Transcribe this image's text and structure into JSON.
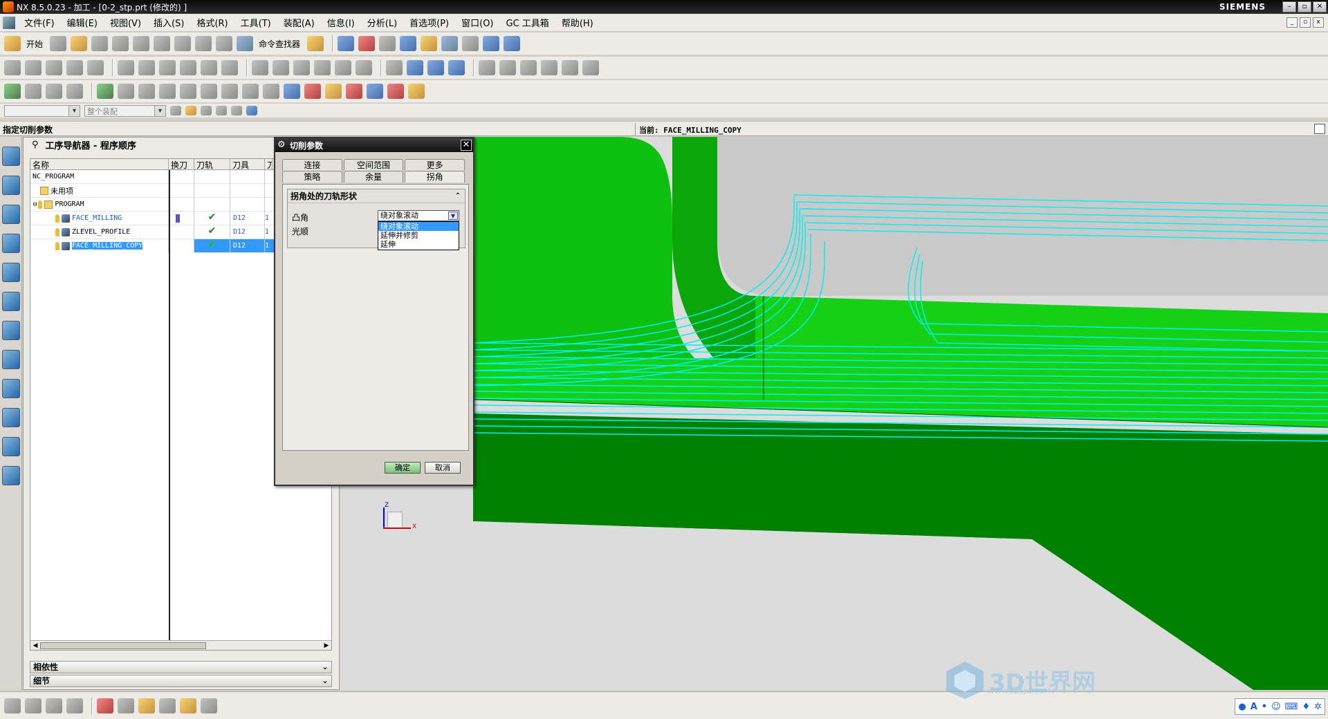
{
  "window": {
    "title": "NX 8.5.0.23 - 加工 - [0-2_stp.prt  (修改的) ]",
    "brand": "SIEMENS",
    "min_icon": "minimize-icon",
    "max_icon": "maximize-icon",
    "close_icon": "close-icon"
  },
  "menu": {
    "items": [
      "文件(F)",
      "编辑(E)",
      "视图(V)",
      "插入(S)",
      "格式(R)",
      "工具(T)",
      "装配(A)",
      "信息(I)",
      "分析(L)",
      "首选项(P)",
      "窗口(O)",
      "GC 工具箱",
      "帮助(H)"
    ]
  },
  "toolbar": {
    "start_label": "开始",
    "cmd_finder_label": "命令查找器"
  },
  "selection_bar": {
    "filter_placeholder": "",
    "scope_placeholder": "整个装配"
  },
  "cue": {
    "prompt": "指定切削参数",
    "status": "当前: FACE_MILLING_COPY"
  },
  "navigator": {
    "title": "工序导航器 - 程序顺序",
    "columns": [
      "名称",
      "换刀",
      "刀轨",
      "刀具",
      "刀"
    ],
    "rows": [
      {
        "name": "NC_PROGRAM",
        "indent": 0,
        "icon": "none",
        "tc": "",
        "path": "",
        "tool": "",
        "more": ""
      },
      {
        "name": "未用项",
        "indent": 1,
        "icon": "folder-icon",
        "tc": "",
        "path": "",
        "tool": "",
        "more": ""
      },
      {
        "name": "PROGRAM",
        "indent": 1,
        "icon": "folder-icon",
        "tc": "",
        "path": "",
        "tool": "",
        "more": ""
      },
      {
        "name": "FACE_MILLING",
        "indent": 2,
        "icon": "operation-icon",
        "tc": "bar",
        "path": "✔",
        "tool": "D12",
        "more": "1"
      },
      {
        "name": "ZLEVEL_PROFILE",
        "indent": 2,
        "icon": "operation-icon",
        "tc": "",
        "path": "✔",
        "tool": "D12",
        "more": "1"
      },
      {
        "name": "FACE_MILLING_COPY",
        "indent": 2,
        "icon": "operation-icon",
        "tc": "",
        "path": "✔",
        "tool": "D12",
        "more": "1",
        "selected": true
      }
    ],
    "sections": {
      "dependency": "相依性",
      "details": "细节"
    }
  },
  "dialog": {
    "title": "切削参数",
    "tabs_row1": [
      "连接",
      "空间范围",
      "更多"
    ],
    "tabs_row2": [
      "策略",
      "余量",
      "拐角"
    ],
    "active_tab": "拐角",
    "group_title": "拐角处的刀轨形状",
    "convex_label": "凸角",
    "smooth_label": "光顺",
    "convex_value": "绕对象滚动",
    "options": [
      "绕对象滚动",
      "延伸并修剪",
      "延伸"
    ],
    "ok": "确定",
    "cancel": "取消"
  },
  "triad": {
    "z": "Z",
    "x": "X"
  },
  "watermark": {
    "text": "3D世界网",
    "sub": "WWW.3DSJW.COM"
  },
  "colors": {
    "part_green": "#16d016",
    "part_dark_green": "#008000",
    "toolpath": "#00f0f0",
    "highlight": "#3399ff"
  }
}
